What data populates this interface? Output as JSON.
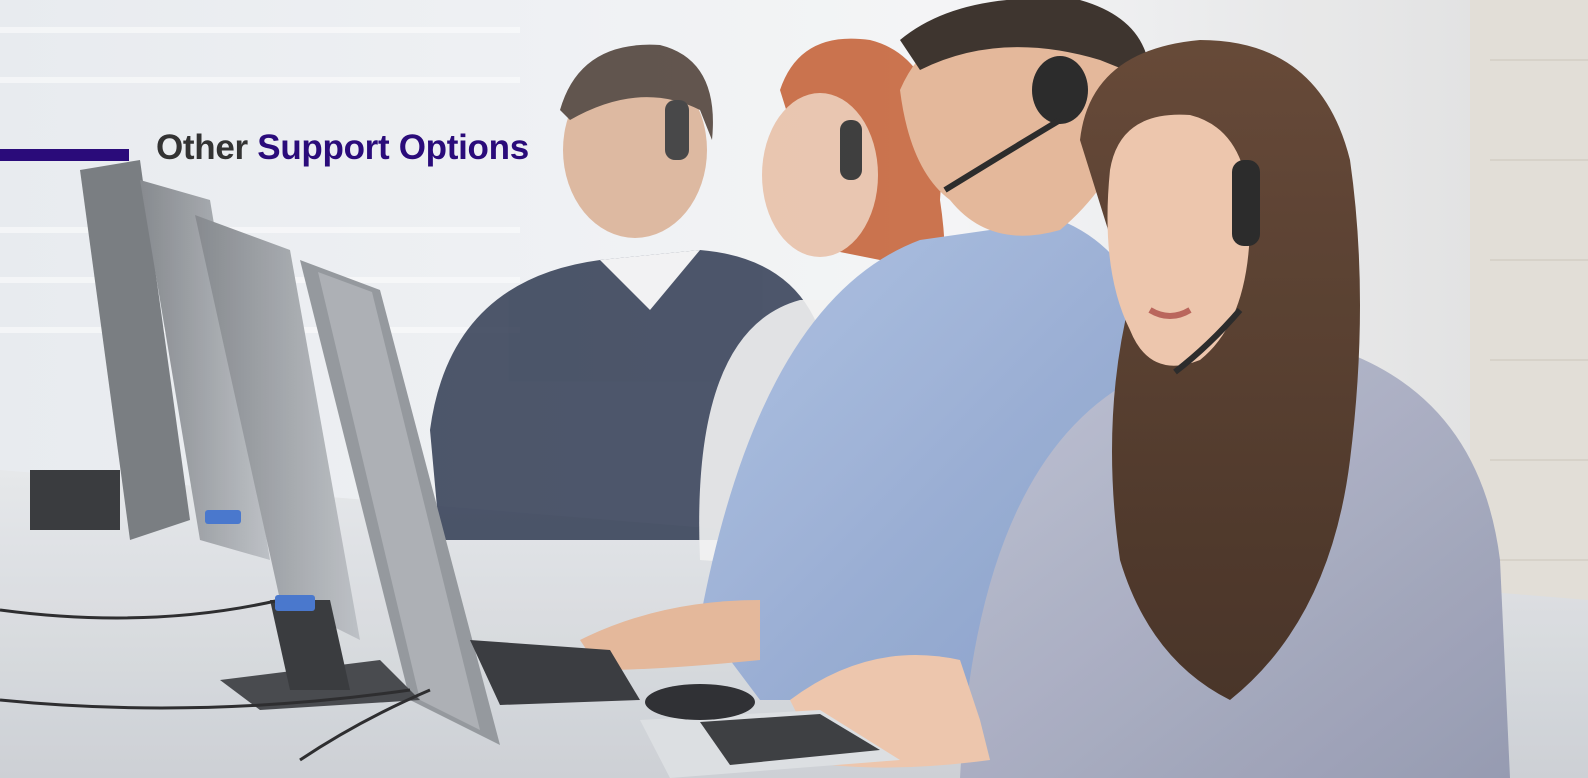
{
  "section": {
    "title_prefix": "Other",
    "title_highlight": "Support Options"
  },
  "colors": {
    "accent": "#2a0b7a",
    "title_text": "#333333"
  },
  "hero_image": {
    "subject": "customer-support-agents-photo"
  }
}
